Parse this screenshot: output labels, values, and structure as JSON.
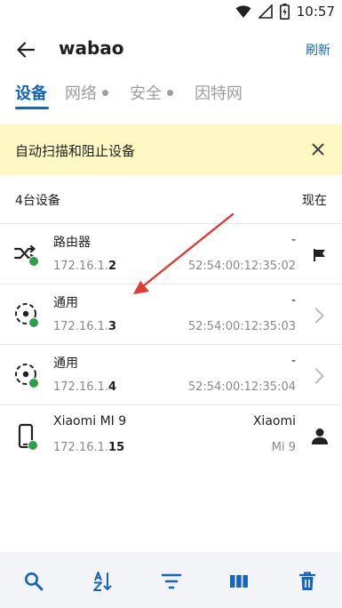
{
  "status_bar": {
    "time": "10:57"
  },
  "app_bar": {
    "title": "wabao",
    "refresh_label": "刷新"
  },
  "tabs": [
    {
      "label": "设备",
      "active": true
    },
    {
      "label": "网络",
      "active": false
    },
    {
      "label": "安全",
      "active": false
    },
    {
      "label": "因特网",
      "active": false
    }
  ],
  "banner": {
    "text": "自动扫描和阻止设备"
  },
  "list_header": {
    "count_label": "4台设备",
    "sort_label": "现在"
  },
  "devices": [
    {
      "name": "路由器",
      "ip_prefix": "172.16.1.",
      "ip_suffix": "2",
      "right_top": "-",
      "right_bottom": "52:54:00:12:35:02",
      "icon": "router-shuffle-icon",
      "action_icon": "flag-icon"
    },
    {
      "name": "通用",
      "ip_prefix": "172.16.1.",
      "ip_suffix": "3",
      "right_top": "-",
      "right_bottom": "52:54:00:12:35:03",
      "icon": "generic-device-icon",
      "action_icon": "chevron-right-icon"
    },
    {
      "name": "通用",
      "ip_prefix": "172.16.1.",
      "ip_suffix": "4",
      "right_top": "-",
      "right_bottom": "52:54:00:12:35:04",
      "icon": "generic-device-icon",
      "action_icon": "chevron-right-icon"
    },
    {
      "name": "Xiaomi MI 9",
      "ip_prefix": "172.16.1.",
      "ip_suffix": "15",
      "right_top": "Xiaomi",
      "right_bottom": "Mi 9",
      "icon": "phone-icon",
      "action_icon": "person-icon"
    }
  ],
  "bottom_bar": [
    "search-icon",
    "sort-az-icon",
    "filter-icon",
    "columns-icon",
    "delete-icon"
  ],
  "colors": {
    "accent": "#1565c0",
    "banner_bg": "#fdf8c4",
    "online": "#2e9e4c",
    "arrow": "#e53935"
  }
}
